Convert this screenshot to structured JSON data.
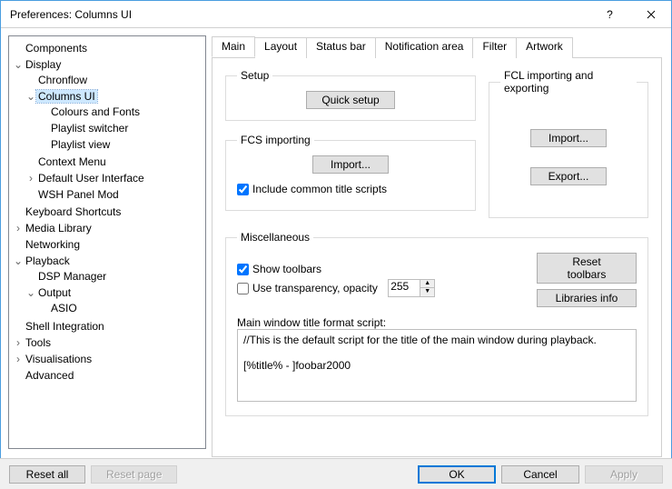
{
  "window": {
    "title": "Preferences: Columns UI"
  },
  "tree": {
    "items": [
      {
        "label": "Components",
        "exp": null,
        "children": []
      },
      {
        "label": "Display",
        "exp": true,
        "children": [
          {
            "label": "Chronflow",
            "exp": null
          },
          {
            "label": "Columns UI",
            "exp": true,
            "selected": true,
            "children": [
              {
                "label": "Colours and Fonts",
                "exp": null
              },
              {
                "label": "Playlist switcher",
                "exp": null
              },
              {
                "label": "Playlist view",
                "exp": null
              }
            ]
          },
          {
            "label": "Context Menu",
            "exp": null
          },
          {
            "label": "Default User Interface",
            "exp": false
          },
          {
            "label": "WSH Panel Mod",
            "exp": null
          }
        ]
      },
      {
        "label": "Keyboard Shortcuts",
        "exp": null
      },
      {
        "label": "Media Library",
        "exp": false
      },
      {
        "label": "Networking",
        "exp": null
      },
      {
        "label": "Playback",
        "exp": true,
        "children": [
          {
            "label": "DSP Manager",
            "exp": null
          },
          {
            "label": "Output",
            "exp": true,
            "children": [
              {
                "label": "ASIO",
                "exp": null
              }
            ]
          }
        ]
      },
      {
        "label": "Shell Integration",
        "exp": null
      },
      {
        "label": "Tools",
        "exp": false
      },
      {
        "label": "Visualisations",
        "exp": false
      },
      {
        "label": "Advanced",
        "exp": null
      }
    ]
  },
  "tabs": [
    "Main",
    "Layout",
    "Status bar",
    "Notification area",
    "Filter",
    "Artwork"
  ],
  "active_tab": 0,
  "setup": {
    "legend": "Setup",
    "quick": "Quick setup"
  },
  "fcl": {
    "legend": "FCL importing and exporting",
    "import": "Import...",
    "export": "Export..."
  },
  "fcs": {
    "legend": "FCS importing",
    "import": "Import...",
    "include_label": "Include common title scripts",
    "include_checked": true
  },
  "misc": {
    "legend": "Miscellaneous",
    "show_toolbars_label": "Show toolbars",
    "show_toolbars_checked": true,
    "use_transparency_label": "Use transparency, opacity",
    "use_transparency_checked": false,
    "opacity_value": "255",
    "reset_toolbars": "Reset toolbars",
    "libraries_info": "Libraries info",
    "script_label": "Main window title format script:",
    "script_text": "//This is the default script for the title of the main window during playback.\n\n[%title% - ]foobar2000"
  },
  "footer": {
    "reset_all": "Reset all",
    "reset_page": "Reset page",
    "ok": "OK",
    "cancel": "Cancel",
    "apply": "Apply"
  }
}
